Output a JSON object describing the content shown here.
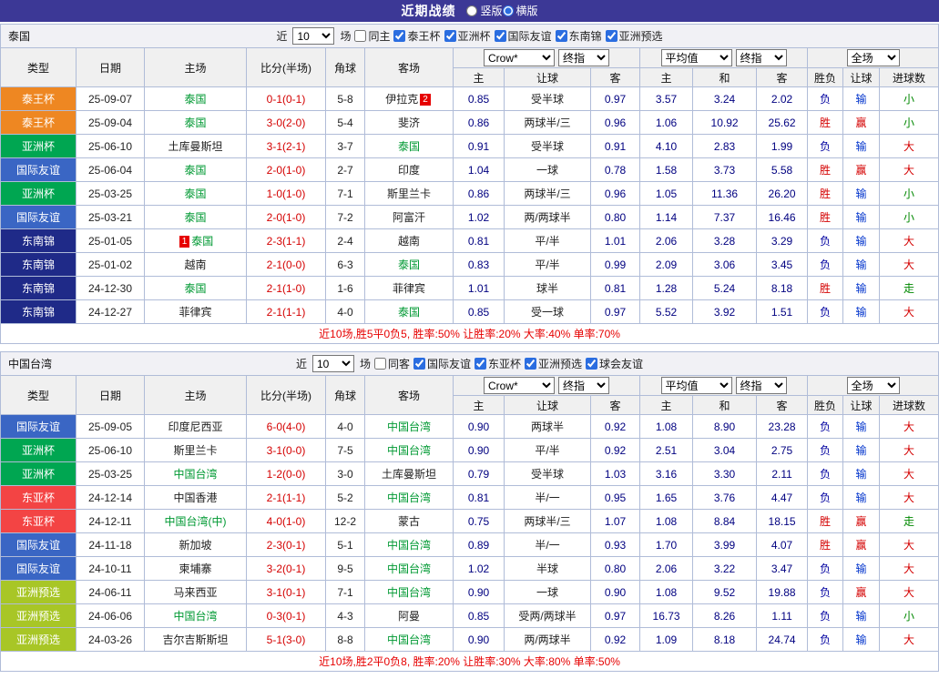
{
  "header": {
    "title": "近期战绩",
    "layout_options": [
      {
        "label": "竖版",
        "checked": false
      },
      {
        "label": "横版",
        "checked": true
      }
    ]
  },
  "table_header": {
    "static_cols": [
      "类型",
      "日期",
      "主场",
      "比分(半场)",
      "角球",
      "客场"
    ],
    "odds_selects": [
      "Crow*",
      "终指"
    ],
    "odds_cols": [
      "主",
      "让球",
      "客"
    ],
    "avg_selects": [
      "平均值",
      "终指"
    ],
    "avg_cols": [
      "主",
      "和",
      "客"
    ],
    "result_select": "全场",
    "result_cols": [
      "胜负",
      "让球",
      "进球数"
    ]
  },
  "type_colors": {
    "泰王杯": "#ee8722",
    "亚洲杯": "#00a651",
    "国际友谊": "#3a66c4",
    "东南锦": "#1f2a88",
    "东亚杯": "#f34444",
    "亚洲预选": "#a8c626"
  },
  "result_colors": {
    "胜": "#d40000",
    "负": "#0000a0",
    "赢": "#d40000",
    "输": "#0033cc",
    "大": "#d40000",
    "小": "#008800",
    "走": "#008800"
  },
  "sections": [
    {
      "team": "泰国",
      "filter": {
        "near": "近",
        "games": "10",
        "games_suffix": "场",
        "same": "同主",
        "same_checked": false,
        "competitions": [
          "泰王杯",
          "亚洲杯",
          "国际友谊",
          "东南锦",
          "亚洲预选"
        ]
      },
      "rows": [
        {
          "type": "泰王杯",
          "date": "25-09-07",
          "home": "泰国",
          "home_focal": true,
          "home_rank": "",
          "score": "0-1(0-1)",
          "corner": "5-8",
          "away": "伊拉克",
          "away_focal": false,
          "away_rank": "2",
          "odds": [
            "0.85",
            "受半球",
            "0.97"
          ],
          "avg": [
            "3.57",
            "3.24",
            "2.02"
          ],
          "results": [
            "负",
            "输",
            "小"
          ]
        },
        {
          "type": "泰王杯",
          "date": "25-09-04",
          "home": "泰国",
          "home_focal": true,
          "home_rank": "",
          "score": "3-0(2-0)",
          "corner": "5-4",
          "away": "斐济",
          "away_focal": false,
          "away_rank": "",
          "odds": [
            "0.86",
            "两球半/三",
            "0.96"
          ],
          "avg": [
            "1.06",
            "10.92",
            "25.62"
          ],
          "results": [
            "胜",
            "赢",
            "小"
          ]
        },
        {
          "type": "亚洲杯",
          "date": "25-06-10",
          "home": "土库曼斯坦",
          "home_focal": false,
          "home_rank": "",
          "score": "3-1(2-1)",
          "corner": "3-7",
          "away": "泰国",
          "away_focal": true,
          "away_rank": "",
          "odds": [
            "0.91",
            "受半球",
            "0.91"
          ],
          "avg": [
            "4.10",
            "2.83",
            "1.99"
          ],
          "results": [
            "负",
            "输",
            "大"
          ]
        },
        {
          "type": "国际友谊",
          "date": "25-06-04",
          "home": "泰国",
          "home_focal": true,
          "home_rank": "",
          "score": "2-0(1-0)",
          "corner": "2-7",
          "away": "印度",
          "away_focal": false,
          "away_rank": "",
          "odds": [
            "1.04",
            "一球",
            "0.78"
          ],
          "avg": [
            "1.58",
            "3.73",
            "5.58"
          ],
          "results": [
            "胜",
            "赢",
            "大"
          ]
        },
        {
          "type": "亚洲杯",
          "date": "25-03-25",
          "home": "泰国",
          "home_focal": true,
          "home_rank": "",
          "score": "1-0(1-0)",
          "corner": "7-1",
          "away": "斯里兰卡",
          "away_focal": false,
          "away_rank": "",
          "odds": [
            "0.86",
            "两球半/三",
            "0.96"
          ],
          "avg": [
            "1.05",
            "11.36",
            "26.20"
          ],
          "results": [
            "胜",
            "输",
            "小"
          ]
        },
        {
          "type": "国际友谊",
          "date": "25-03-21",
          "home": "泰国",
          "home_focal": true,
          "home_rank": "",
          "score": "2-0(1-0)",
          "corner": "7-2",
          "away": "阿富汗",
          "away_focal": false,
          "away_rank": "",
          "odds": [
            "1.02",
            "两/两球半",
            "0.80"
          ],
          "avg": [
            "1.14",
            "7.37",
            "16.46"
          ],
          "results": [
            "胜",
            "输",
            "小"
          ]
        },
        {
          "type": "东南锦",
          "date": "25-01-05",
          "home": "泰国",
          "home_focal": true,
          "home_rank": "1",
          "score": "2-3(1-1)",
          "corner": "2-4",
          "away": "越南",
          "away_focal": false,
          "away_rank": "",
          "odds": [
            "0.81",
            "平/半",
            "1.01"
          ],
          "avg": [
            "2.06",
            "3.28",
            "3.29"
          ],
          "results": [
            "负",
            "输",
            "大"
          ]
        },
        {
          "type": "东南锦",
          "date": "25-01-02",
          "home": "越南",
          "home_focal": false,
          "home_rank": "",
          "score": "2-1(0-0)",
          "corner": "6-3",
          "away": "泰国",
          "away_focal": true,
          "away_rank": "",
          "odds": [
            "0.83",
            "平/半",
            "0.99"
          ],
          "avg": [
            "2.09",
            "3.06",
            "3.45"
          ],
          "results": [
            "负",
            "输",
            "大"
          ]
        },
        {
          "type": "东南锦",
          "date": "24-12-30",
          "home": "泰国",
          "home_focal": true,
          "home_rank": "",
          "score": "2-1(1-0)",
          "corner": "1-6",
          "away": "菲律宾",
          "away_focal": false,
          "away_rank": "",
          "odds": [
            "1.01",
            "球半",
            "0.81"
          ],
          "avg": [
            "1.28",
            "5.24",
            "8.18"
          ],
          "results": [
            "胜",
            "输",
            "走"
          ]
        },
        {
          "type": "东南锦",
          "date": "24-12-27",
          "home": "菲律宾",
          "home_focal": false,
          "home_rank": "",
          "score": "2-1(1-1)",
          "corner": "4-0",
          "away": "泰国",
          "away_focal": true,
          "away_rank": "",
          "odds": [
            "0.85",
            "受一球",
            "0.97"
          ],
          "avg": [
            "5.52",
            "3.92",
            "1.51"
          ],
          "results": [
            "负",
            "输",
            "大"
          ]
        }
      ],
      "summary": "近10场,胜5平0负5, 胜率:50% 让胜率:20% 大率:40% 单率:70%"
    },
    {
      "team": "中国台湾",
      "filter": {
        "near": "近",
        "games": "10",
        "games_suffix": "场",
        "same": "同客",
        "same_checked": false,
        "competitions": [
          "国际友谊",
          "东亚杯",
          "亚洲预选",
          "球会友谊"
        ]
      },
      "rows": [
        {
          "type": "国际友谊",
          "date": "25-09-05",
          "home": "印度尼西亚",
          "home_focal": false,
          "home_rank": "",
          "score": "6-0(4-0)",
          "corner": "4-0",
          "away": "中国台湾",
          "away_focal": true,
          "away_rank": "",
          "odds": [
            "0.90",
            "两球半",
            "0.92"
          ],
          "avg": [
            "1.08",
            "8.90",
            "23.28"
          ],
          "results": [
            "负",
            "输",
            "大"
          ]
        },
        {
          "type": "亚洲杯",
          "date": "25-06-10",
          "home": "斯里兰卡",
          "home_focal": false,
          "home_rank": "",
          "score": "3-1(0-0)",
          "corner": "7-5",
          "away": "中国台湾",
          "away_focal": true,
          "away_rank": "",
          "odds": [
            "0.90",
            "平/半",
            "0.92"
          ],
          "avg": [
            "2.51",
            "3.04",
            "2.75"
          ],
          "results": [
            "负",
            "输",
            "大"
          ]
        },
        {
          "type": "亚洲杯",
          "date": "25-03-25",
          "home": "中国台湾",
          "home_focal": true,
          "home_rank": "",
          "score": "1-2(0-0)",
          "corner": "3-0",
          "away": "土库曼斯坦",
          "away_focal": false,
          "away_rank": "",
          "odds": [
            "0.79",
            "受半球",
            "1.03"
          ],
          "avg": [
            "3.16",
            "3.30",
            "2.11"
          ],
          "results": [
            "负",
            "输",
            "大"
          ]
        },
        {
          "type": "东亚杯",
          "date": "24-12-14",
          "home": "中国香港",
          "home_focal": false,
          "home_rank": "",
          "score": "2-1(1-1)",
          "corner": "5-2",
          "away": "中国台湾",
          "away_focal": true,
          "away_rank": "",
          "odds": [
            "0.81",
            "半/一",
            "0.95"
          ],
          "avg": [
            "1.65",
            "3.76",
            "4.47"
          ],
          "results": [
            "负",
            "输",
            "大"
          ]
        },
        {
          "type": "东亚杯",
          "date": "24-12-11",
          "home": "中国台湾(中)",
          "home_focal": true,
          "home_rank": "",
          "score": "4-0(1-0)",
          "corner": "12-2",
          "away": "蒙古",
          "away_focal": false,
          "away_rank": "",
          "odds": [
            "0.75",
            "两球半/三",
            "1.07"
          ],
          "avg": [
            "1.08",
            "8.84",
            "18.15"
          ],
          "results": [
            "胜",
            "赢",
            "走"
          ]
        },
        {
          "type": "国际友谊",
          "date": "24-11-18",
          "home": "新加坡",
          "home_focal": false,
          "home_rank": "",
          "score": "2-3(0-1)",
          "corner": "5-1",
          "away": "中国台湾",
          "away_focal": true,
          "away_rank": "",
          "odds": [
            "0.89",
            "半/一",
            "0.93"
          ],
          "avg": [
            "1.70",
            "3.99",
            "4.07"
          ],
          "results": [
            "胜",
            "赢",
            "大"
          ]
        },
        {
          "type": "国际友谊",
          "date": "24-10-11",
          "home": "柬埔寨",
          "home_focal": false,
          "home_rank": "",
          "score": "3-2(0-1)",
          "corner": "9-5",
          "away": "中国台湾",
          "away_focal": true,
          "away_rank": "",
          "odds": [
            "1.02",
            "半球",
            "0.80"
          ],
          "avg": [
            "2.06",
            "3.22",
            "3.47"
          ],
          "results": [
            "负",
            "输",
            "大"
          ]
        },
        {
          "type": "亚洲预选",
          "date": "24-06-11",
          "home": "马来西亚",
          "home_focal": false,
          "home_rank": "",
          "score": "3-1(0-1)",
          "corner": "7-1",
          "away": "中国台湾",
          "away_focal": true,
          "away_rank": "",
          "odds": [
            "0.90",
            "一球",
            "0.90"
          ],
          "avg": [
            "1.08",
            "9.52",
            "19.88"
          ],
          "results": [
            "负",
            "赢",
            "大"
          ]
        },
        {
          "type": "亚洲预选",
          "date": "24-06-06",
          "home": "中国台湾",
          "home_focal": true,
          "home_rank": "",
          "score": "0-3(0-1)",
          "corner": "4-3",
          "away": "阿曼",
          "away_focal": false,
          "away_rank": "",
          "odds": [
            "0.85",
            "受两/两球半",
            "0.97"
          ],
          "avg": [
            "16.73",
            "8.26",
            "1.11"
          ],
          "results": [
            "负",
            "输",
            "小"
          ]
        },
        {
          "type": "亚洲预选",
          "date": "24-03-26",
          "home": "吉尔吉斯斯坦",
          "home_focal": false,
          "home_rank": "",
          "score": "5-1(3-0)",
          "corner": "8-8",
          "away": "中国台湾",
          "away_focal": true,
          "away_rank": "",
          "odds": [
            "0.90",
            "两/两球半",
            "0.92"
          ],
          "avg": [
            "1.09",
            "8.18",
            "24.74"
          ],
          "results": [
            "负",
            "输",
            "大"
          ]
        }
      ],
      "summary": "近10场,胜2平0负8, 胜率:20% 让胜率:30% 大率:80% 单率:50%"
    }
  ]
}
